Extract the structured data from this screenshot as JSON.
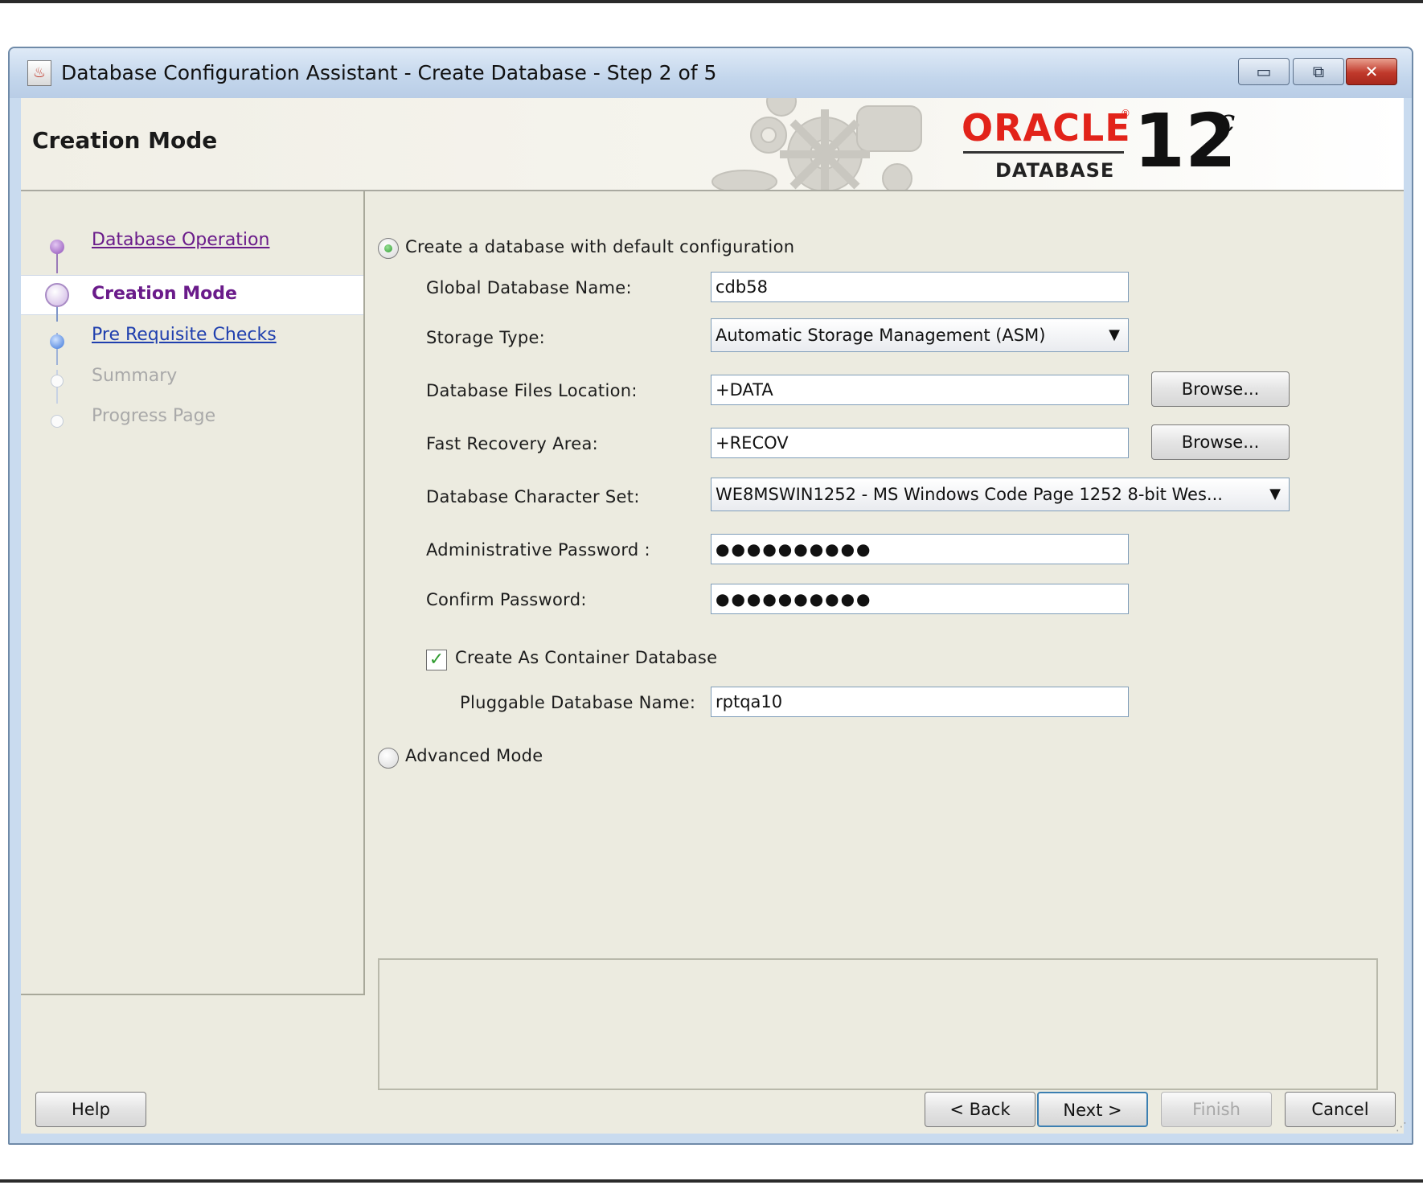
{
  "window": {
    "title": "Database Configuration Assistant - Create Database - Step 2 of 5",
    "controls": {
      "minimize": "▭",
      "maximize": "⧉",
      "close": "✕"
    }
  },
  "header": {
    "title": "Creation Mode",
    "brand": {
      "word": "ORACLE",
      "reg": "®",
      "product": "DATABASE",
      "version": "12",
      "suffix": "c"
    }
  },
  "steps": [
    {
      "label": "Database Operation",
      "state": "visited"
    },
    {
      "label": "Creation Mode",
      "state": "current"
    },
    {
      "label": "Pre Requisite Checks",
      "state": "next"
    },
    {
      "label": "Summary",
      "state": "disabled"
    },
    {
      "label": "Progress Page",
      "state": "disabled"
    }
  ],
  "form": {
    "default_config": {
      "label": "Create a database with default configuration",
      "selected": true
    },
    "global_db_name": {
      "label": "Global Database Name:",
      "value": "cdb58"
    },
    "storage_type": {
      "label": "Storage Type:",
      "value": "Automatic Storage Management (ASM)"
    },
    "db_files_location": {
      "label": "Database Files Location:",
      "value": "+DATA",
      "browse": "Browse..."
    },
    "fast_recovery_area": {
      "label": "Fast Recovery Area:",
      "value": "+RECOV",
      "browse": "Browse..."
    },
    "charset": {
      "label": "Database Character Set:",
      "value": "WE8MSWIN1252 - MS Windows Code Page 1252 8-bit Wes..."
    },
    "admin_password": {
      "label": "Administrative Password :",
      "value": "●●●●●●●●●●"
    },
    "confirm_password": {
      "label": "Confirm Password:",
      "value": "●●●●●●●●●●"
    },
    "container_db": {
      "label": "Create As Container Database",
      "checked": true,
      "check_glyph": "✓"
    },
    "pluggable_db_name": {
      "label": "Pluggable Database Name:",
      "value": "rptqa10"
    },
    "advanced_mode": {
      "label": "Advanced Mode",
      "selected": false
    }
  },
  "footer": {
    "help": "Help",
    "back": "< Back",
    "next": "Next >",
    "finish": "Finish",
    "cancel": "Cancel"
  }
}
